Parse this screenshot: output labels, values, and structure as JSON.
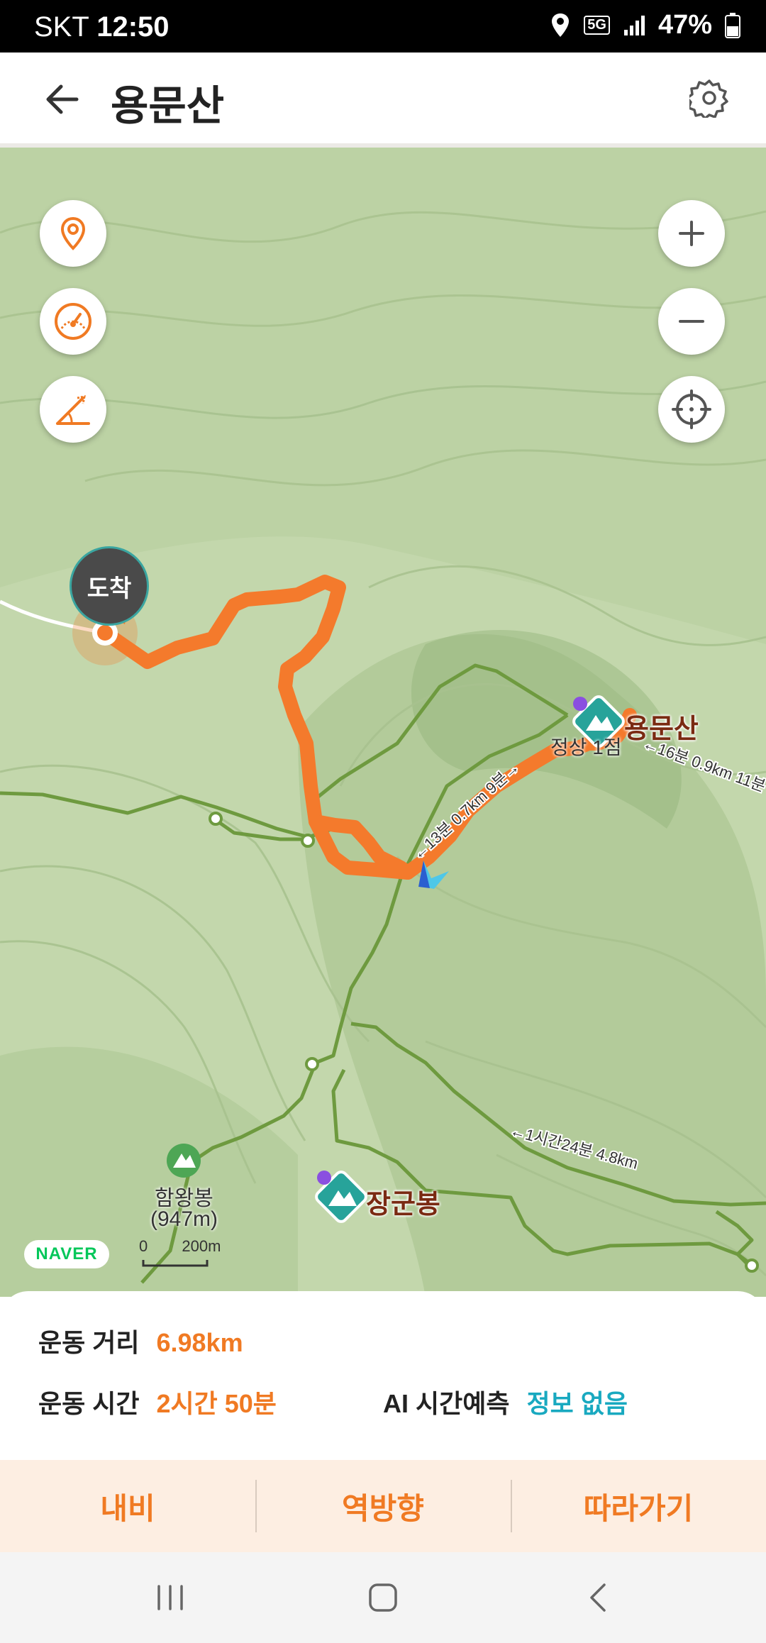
{
  "status": {
    "carrier": "SKT",
    "time": "12:50",
    "network": "5G",
    "battery": "47%"
  },
  "header": {
    "title": "용문산",
    "back_icon": "arrow-left-icon",
    "settings_icon": "gear-icon"
  },
  "map": {
    "arrive_label": "도착",
    "peaks": [
      {
        "name": "용문산",
        "sub": "정상 1점"
      },
      {
        "name": "장군봉"
      },
      {
        "name": "함왕봉",
        "sub": "(947m)"
      }
    ],
    "trail_labels": [
      "←13분 0.7km 9분→",
      "←16분 0.9km 11분",
      "←1시간24분 4.8km"
    ],
    "brand": "NAVER",
    "scale": {
      "start": "0",
      "end": "200m"
    },
    "route_color": "#f47a2c"
  },
  "stats": {
    "distance_label": "운동 거리",
    "distance_value": "6.98km",
    "time_label": "운동 시간",
    "time_value": "2시간 50분",
    "ai_label": "AI 시간예측",
    "ai_value": "정보 없음"
  },
  "actions": {
    "nav": "내비",
    "reverse": "역방향",
    "follow": "따라가기"
  }
}
